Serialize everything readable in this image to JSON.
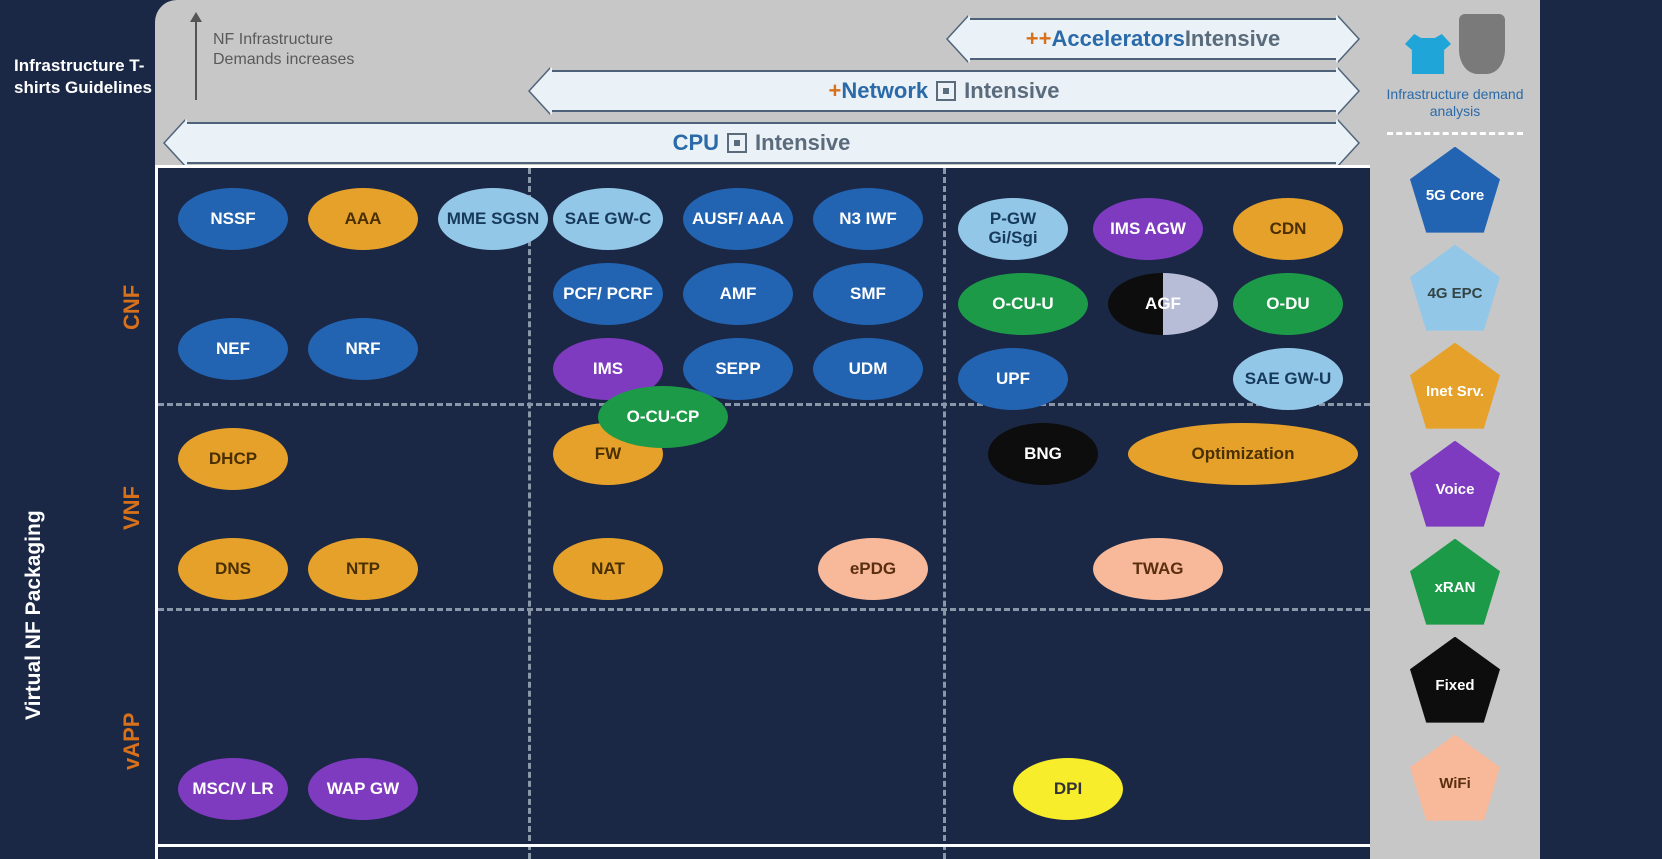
{
  "titles": {
    "left_top": "Infrastructure T-shirts Guidelines",
    "vertical": "Virtual NF Packaging",
    "header_note_l1": "NF Infrastructure",
    "header_note_l2": "Demands increases",
    "legend_caption": "Infrastructure demand analysis"
  },
  "bands": {
    "b1_prefix": "CPU ",
    "b2_prefix": "+",
    "b2_main": "Network ",
    "b3_prefix": "++",
    "b3_main": "Accelerators ",
    "suffix": "Intensive"
  },
  "rows": {
    "r1": "CNF",
    "r2": "VNF",
    "r3": "vAPP"
  },
  "legend": [
    {
      "label": "5G Core",
      "color": "#2264b2"
    },
    {
      "label": "4G EPC",
      "color": "#93c7e8"
    },
    {
      "label": "Inet Srv.",
      "color": "#e6a12a"
    },
    {
      "label": "Voice",
      "color": "#7e3bbf"
    },
    {
      "label": "xRAN",
      "color": "#1c9a48"
    },
    {
      "label": "Fixed",
      "color": "#0d0d0d"
    },
    {
      "label": "WiFi",
      "color": "#f8b89a"
    }
  ],
  "nodes": {
    "nssf": "NSSF",
    "aaa": "AAA",
    "mme": "MME SGSN",
    "sae_c": "SAE GW-C",
    "ausf": "AUSF/ AAA",
    "n3": "N3 IWF",
    "pgw": "P-GW Gi/Sgi",
    "imsagw": "IMS AGW",
    "cdn": "CDN",
    "pcf": "PCF/ PCRF",
    "amf": "AMF",
    "smf": "SMF",
    "ocu_u": "O-CU-U",
    "agf": "AGF",
    "odu": "O-DU",
    "nef": "NEF",
    "nrf": "NRF",
    "ims": "IMS",
    "sepp": "SEPP",
    "udm": "UDM",
    "upf": "UPF",
    "sae_u": "SAE GW-U",
    "ocu_cp": "O-CU-CP",
    "dhcp": "DHCP",
    "fw": "FW",
    "bng": "BNG",
    "opt": "Optimization",
    "dns": "DNS",
    "ntp": "NTP",
    "nat": "NAT",
    "epdg": "ePDG",
    "twag": "TWAG",
    "msc": "MSC/V LR",
    "wap": "WAP GW",
    "dpi": "DPI"
  }
}
